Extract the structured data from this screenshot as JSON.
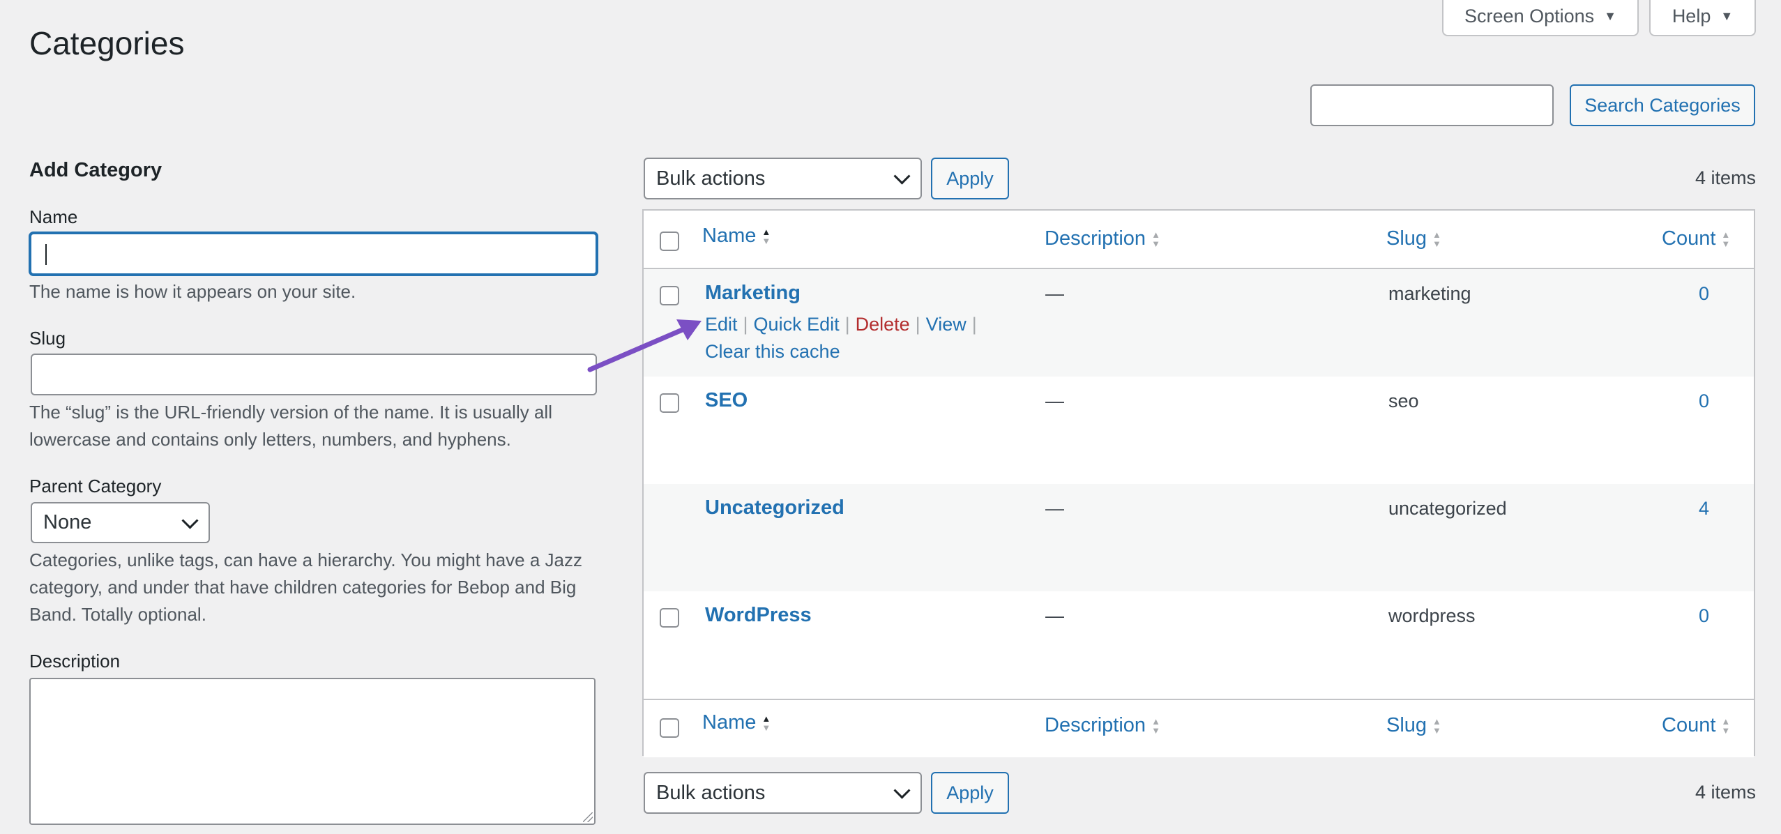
{
  "header": {
    "title": "Categories",
    "screen_options": "Screen Options",
    "help": "Help"
  },
  "search": {
    "value": "",
    "button": "Search Categories"
  },
  "form": {
    "title": "Add Category",
    "name_label": "Name",
    "name_help": "The name is how it appears on your site.",
    "slug_label": "Slug",
    "slug_help": "The “slug” is the URL-friendly version of the name. It is usually all lowercase and contains only letters, numbers, and hyphens.",
    "parent_label": "Parent Category",
    "parent_value": "None",
    "parent_help": "Categories, unlike tags, can have a hierarchy. You might have a Jazz category, and under that have children categories for Bebop and Big Band. Totally optional.",
    "description_label": "Description"
  },
  "bulk": {
    "top_select": "Bulk actions",
    "top_apply": "Apply",
    "bottom_select": "Bulk actions",
    "bottom_apply": "Apply",
    "items_top": "4 items",
    "items_bottom": "4 items"
  },
  "table": {
    "columns": {
      "name": "Name",
      "description": "Description",
      "slug": "Slug",
      "count": "Count"
    },
    "rows": [
      {
        "name": "Marketing",
        "description": "—",
        "slug": "marketing",
        "count": "0"
      },
      {
        "name": "SEO",
        "description": "—",
        "slug": "seo",
        "count": "0"
      },
      {
        "name": "Uncategorized",
        "description": "—",
        "slug": "uncategorized",
        "count": "4"
      },
      {
        "name": "WordPress",
        "description": "—",
        "slug": "wordpress",
        "count": "0"
      }
    ],
    "row_actions": {
      "edit": "Edit",
      "quick_edit": "Quick Edit",
      "delete": "Delete",
      "view": "View",
      "clear_cache": "Clear this cache",
      "separator": "|"
    }
  },
  "colors": {
    "accent": "#2271b1",
    "delete": "#b32d2e",
    "annotation_arrow": "#7b4fc4",
    "background": "#f0f0f1"
  },
  "icons": {
    "dropdown": "triangle-down-icon",
    "sort": "sort-arrows-icon",
    "select": "chevron-down-icon",
    "annotation": "arrow-annotation-icon"
  }
}
